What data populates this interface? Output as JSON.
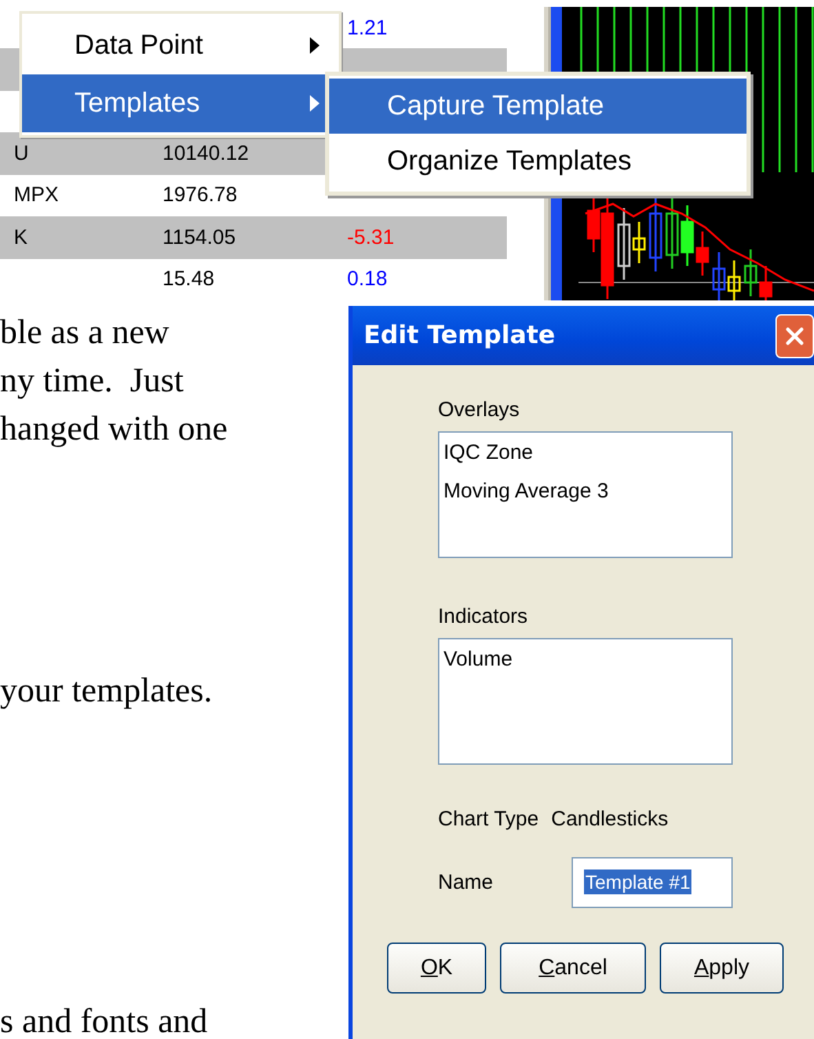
{
  "quotes": {
    "rows": [
      {
        "column_3": "1.21",
        "color": "#0000ff"
      },
      {},
      {},
      {
        "column_1": "U",
        "column_2": "10140.12"
      },
      {
        "column_1": "MPX",
        "column_2": "1976.78"
      },
      {
        "column_1": "K",
        "column_2": "1154.05",
        "column_3": "-5.31",
        "color": "#ff0000"
      },
      {
        "column_2": "15.48",
        "column_3": "0.18",
        "color": "#0000ff"
      }
    ]
  },
  "menu": {
    "items": [
      {
        "label": "Data Point",
        "selected": false,
        "submenu": true
      },
      {
        "label": "Templates",
        "selected": true,
        "submenu": true
      }
    ]
  },
  "submenu": {
    "items": [
      {
        "label": "Capture Template",
        "selected": true
      },
      {
        "label": "Organize Templates",
        "selected": false
      }
    ]
  },
  "document": {
    "paragraphs": [
      {
        "lines": [
          "ble as a new",
          "ny time.  Just",
          "hanged with one"
        ]
      },
      {
        "lines": [
          "your templates."
        ]
      },
      {
        "lines": [
          "s and fonts and"
        ]
      }
    ]
  },
  "dialog": {
    "title": "Edit Template",
    "overlays": {
      "label": "Overlays",
      "items": [
        "IQC Zone",
        "Moving Average 3"
      ]
    },
    "indicators": {
      "label": "Indicators",
      "items": [
        "Volume"
      ]
    },
    "chart_type": {
      "label": "Chart Type",
      "value": "Candlesticks"
    },
    "name": {
      "label": "Name",
      "value": "Template #1",
      "selected": true
    },
    "buttons": [
      {
        "label": "OK",
        "mnemonic": true
      },
      {
        "label": "Cancel",
        "mnemonic": true
      },
      {
        "label": "Apply",
        "mnemonic": true
      }
    ]
  }
}
